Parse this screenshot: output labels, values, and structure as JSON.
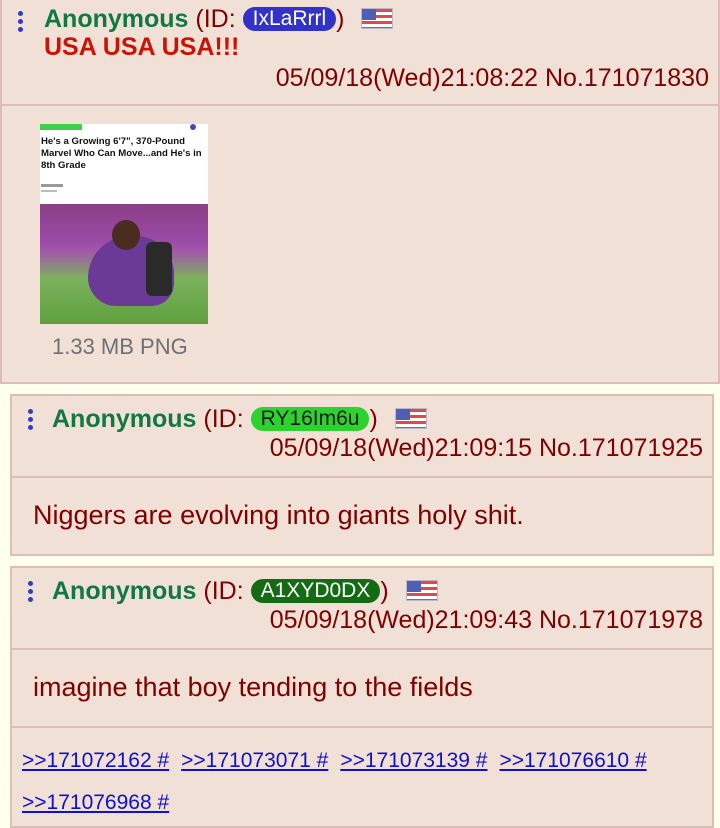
{
  "posts": [
    {
      "name": "Anonymous",
      "id_prefix": "(ID: ",
      "id": "IxLaRrrl",
      "id_color": "#3232c8",
      "id_suffix": ")",
      "flag": "us-flag-icon",
      "subject": "USA USA USA!!!",
      "datetime": "05/09/18(Wed)21:08:22",
      "number": "No.171071830",
      "file": {
        "thumb_headline": "He's a Growing 6'7\", 370-Pound Marvel Who Can Move...and He's in 8th Grade",
        "size": "1.33 MB PNG"
      }
    },
    {
      "name": "Anonymous",
      "id_prefix": "(ID: ",
      "id": "RY16Im6u",
      "id_color": "#2ed22e",
      "id_suffix": ")",
      "flag": "us-flag-icon",
      "datetime": "05/09/18(Wed)21:09:15",
      "number": "No.171071925",
      "message": "Niggers are evolving into giants holy shit."
    },
    {
      "name": "Anonymous",
      "id_prefix": "(ID: ",
      "id": "A1XYD0DX",
      "id_color": "#136b13",
      "id_suffix": ")",
      "flag": "us-flag-icon",
      "datetime": "05/09/18(Wed)21:09:43",
      "number": "No.171071978",
      "message": "imagine that boy tending to the fields",
      "backlinks": [
        ">>171072162 #",
        ">>171073071 #",
        ">>171073139 #",
        ">>171076610 #",
        ">>171076968 #"
      ]
    }
  ],
  "colors": {
    "name": "#117743",
    "subject": "#cc1105",
    "text": "#800000",
    "post_bg": "#f0e0d6",
    "border": "#d9bfb7",
    "link": "#0f0fd0"
  }
}
